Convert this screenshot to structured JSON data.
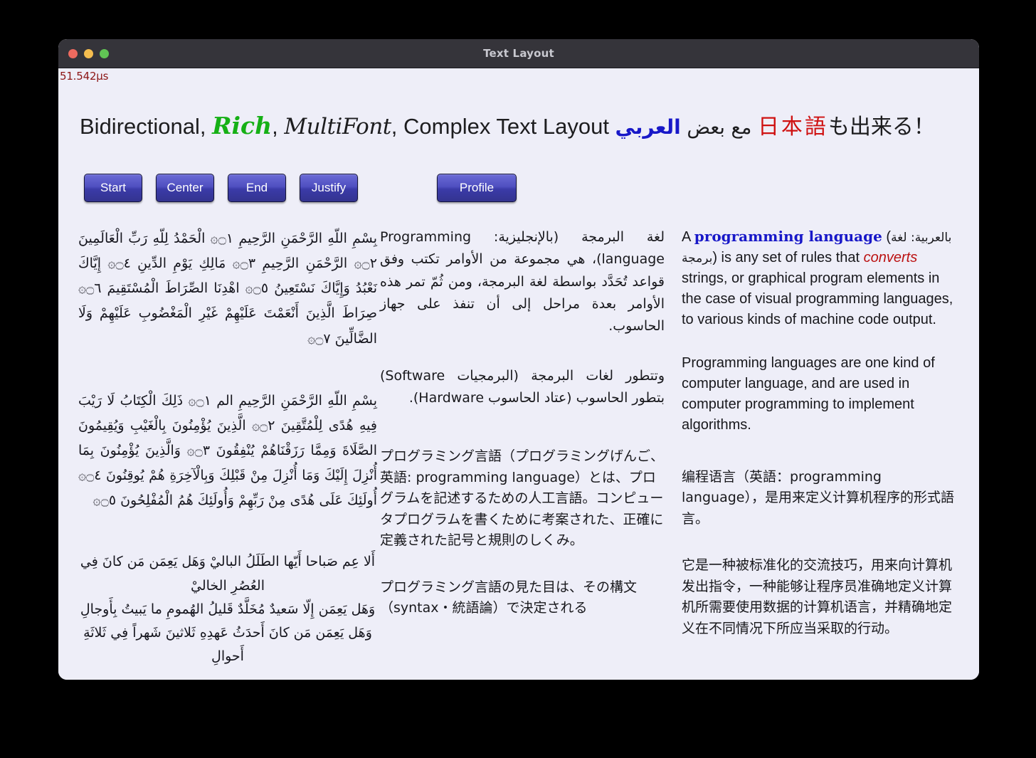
{
  "window": {
    "title": "Text Layout",
    "traffic_lights": [
      {
        "name": "close",
        "color": "#ee6a5f"
      },
      {
        "name": "minimize",
        "color": "#f5bd4f"
      },
      {
        "name": "maximize",
        "color": "#61c554"
      }
    ],
    "background": "#eeeef8",
    "titlebar_color": "#35343a"
  },
  "timing": {
    "value": "51.542µs",
    "color": "#8c1515"
  },
  "headline": {
    "part1": "Bidirectional, ",
    "rich": "Rich",
    "comma1": ", ",
    "script": "MultiFont",
    "comma2": ", ",
    "part2": "Complex Text Layout ",
    "arabic_blue": "العربي",
    "arabic_plain": " مع بعض ",
    "japanese_red": "日本語",
    "japanese_plain": "も出来る！",
    "rich_color": "#16b016",
    "arabic_blue_color": "#1818c8",
    "japanese_red_color": "#cf1111"
  },
  "buttons": [
    {
      "name": "start",
      "label": "Start"
    },
    {
      "name": "center",
      "label": "Center"
    },
    {
      "name": "end",
      "label": "End"
    },
    {
      "name": "justify",
      "label": "Justify"
    },
    {
      "name": "profile",
      "label": "Profile"
    }
  ],
  "columns": {
    "arabic": {
      "fatiha": "بِسْمِ اللّهِ الرَّحْمَنِ الرَّحِيمِ ۝١۞ الْحَمْدُ لِلّهِ رَبِّ الْعَالَمِينَ ۝٢۞ الرَّحْمَنِ الرَّحِيمِ ۝٣۞ مَالِكِ يَوْمِ الدِّينِ ۝٤۞ إِيَّاكَ نَعْبُدُ وَإِيَّاكَ نَسْتَعِينُ ۝٥۞ اهْدِنَا الصِّرَاطَ الْمُسْتَقِيمَ ۝٦۞ صِرَاطَ الَّذِينَ أَنْعَمْتَ عَلَيْهِمْ غَيْرِ الْمَغْضُوبِ عَلَيْهِمْ وَلَا الضَّالِّينَ ۝٧۞",
      "baqara": "بِسْمِ اللّهِ الرَّحْمَنِ الرَّحِيمِ الم ۝١۞ ذَلِكَ الْكِتَابُ لَا رَيْبَ فِيهِ هُدًى لِلْمُتَّقِينَ ۝٢۞ الَّذِينَ يُؤْمِنُونَ بِالْغَيْبِ وَيُقِيمُونَ الصَّلَاةَ وَمِمَّا رَزَقْنَاهُمْ يُنْفِقُونَ ۝٣۞ وَالَّذِينَ يُؤْمِنُونَ بِمَا أُنْزِلَ إِلَيْكَ وَمَا أُنْزِلَ مِنْ قَبْلِكَ وَبِالْآخِرَةِ هُمْ يُوقِنُونَ ۝٤۞ أُولَئِكَ عَلَى هُدًى مِنْ رَبِّهِمْ وَأُولَئِكَ هُمُ الْمُفْلِحُونَ ۝٥۞",
      "poem": "أَلا عِم صَباحا أَيّها الطَلَلُ الباليْ    وَهَل يَعِمَن مَن كانَ فِي العُصُرِ الخاليْ\nوَهَل يَعِمَن إِلّا سَعيدٌ مُخَلَّدٌ    قَليلُ الهُمومِ ما يَبيتُ بِأَوجالِ\nوَهَل يَعِمَن مَن كانَ أَحدَثُ عَهدِهِ    ثَلاثينَ شَهراً فِي ثَلاثَةِ أَحوالِ"
    },
    "middle": {
      "arabic_p1": "لغة البرمجة (بالإنجليزية: Programming language)، هي مجموعة من الأوامر تكتب وفق قواعد تُحَدَّد بواسطة لغة البرمجة، ومن ثُمّ تمر هذه الأوامر بعدة مراحل إلى أن تنفذ على جهاز الحاسوب.",
      "arabic_p2": "وتتطور لغات البرمجة (البرمجيات Software) بتطور الحاسوب (عتاد الحاسوب Hardware).",
      "japanese_p1": "プログラミング言語（プログラミングげんご、英語: programming language）とは、プログラムを記述するための人工言語。コンピュータプログラムを書くために考案された、正確に定義された記号と規則のしくみ。",
      "japanese_p2": "プログラミング言語の見た目は、その構文（syntax・統語論）で決定される"
    },
    "right": {
      "en_p1_a": "A ",
      "en_p1_term": "programming language",
      "en_p1_b": " (",
      "en_p1_arabic": "بالعربية: لغة برمجة",
      "en_p1_c": ") is any set of rules that ",
      "en_p1_converts": "converts",
      "en_p1_d": " strings, or graphical program elements in the case of visual programming languages, to various kinds of machine code output.",
      "en_p2": "Programming languages are one kind of computer language, and are used in computer programming to implement algorithms.",
      "zh_p1": "编程语言（英語：programming language），是用来定义计算机程序的形式語言。",
      "zh_p2": "它是一种被标准化的交流技巧，用来向计算机发出指令，一种能够让程序员准确地定义计算机所需要使用数据的计算机语言，并精确地定义在不同情况下所应当采取的行动。"
    }
  }
}
